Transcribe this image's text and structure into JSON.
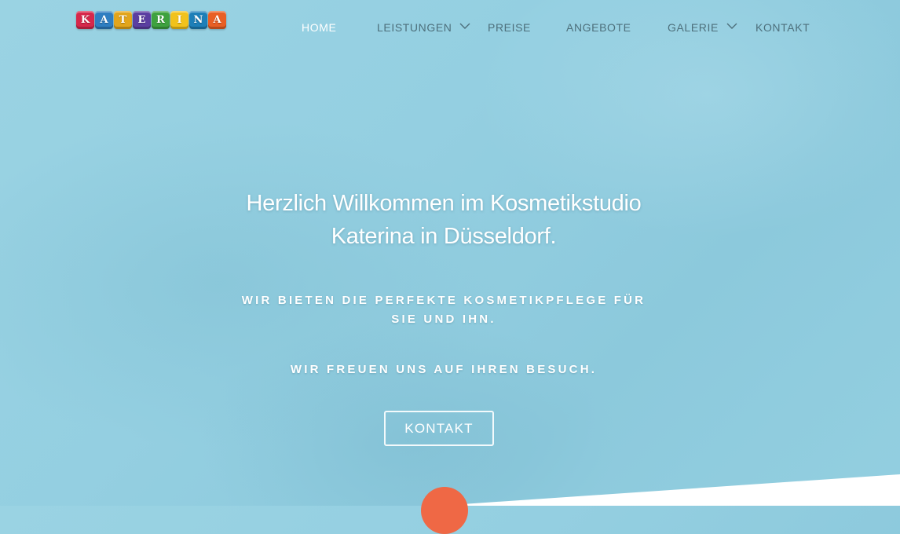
{
  "logo": {
    "letters": [
      "K",
      "A",
      "T",
      "E",
      "R",
      "I",
      "N",
      "A"
    ],
    "colors": [
      "#d6284b",
      "#2f7ec1",
      "#e2a51c",
      "#5b3fa1",
      "#3ea23f",
      "#f1c21c",
      "#1d7fb8",
      "#e85f25"
    ]
  },
  "nav": {
    "items": [
      {
        "label": "HOME",
        "active": true,
        "has_dropdown": false
      },
      {
        "label": "LEISTUNGEN",
        "active": false,
        "has_dropdown": true
      },
      {
        "label": "PREISE",
        "active": false,
        "has_dropdown": false
      },
      {
        "label": "ANGEBOTE",
        "active": false,
        "has_dropdown": false
      },
      {
        "label": "GALERIE",
        "active": false,
        "has_dropdown": true
      },
      {
        "label": "KONTAKT",
        "active": false,
        "has_dropdown": false
      }
    ]
  },
  "hero": {
    "title_line1": "Herzlich Willkommen im Kosmetikstudio",
    "title_line2": "Katerina in Düsseldorf.",
    "subtitle_line1": "WIR BIETEN DIE PERFEKTE KOSMETIKPFLEGE FÜR",
    "subtitle_line2": "SIE UND IHN.",
    "subtitle2": "WIR FREUEN UNS AUF IHREN BESUCH.",
    "button_label": "KONTAKT"
  },
  "colors": {
    "background": "#94cfe1",
    "nav_text": "#4d6f7b",
    "nav_active": "#ffffff",
    "accent": "#ef6845"
  },
  "icons": {
    "dropdown": "chevron-down-icon",
    "scroll": "scroll-down-button"
  }
}
